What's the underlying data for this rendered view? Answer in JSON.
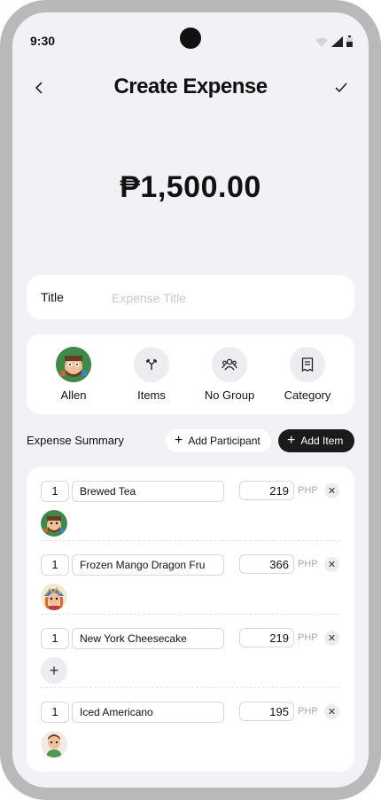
{
  "status": {
    "time": "9:30"
  },
  "header": {
    "title": "Create Expense"
  },
  "amount": "₱1,500.00",
  "title_field": {
    "label": "Title",
    "placeholder": "Expense Title",
    "value": ""
  },
  "options": [
    {
      "label": "Allen",
      "icon": "avatar"
    },
    {
      "label": "Items",
      "icon": "split-icon"
    },
    {
      "label": "No Group",
      "icon": "group-icon"
    },
    {
      "label": "Category",
      "icon": "receipt-icon"
    }
  ],
  "summary": {
    "title": "Expense Summary",
    "add_participant_label": "Add Participant",
    "add_item_label": "Add Item"
  },
  "items": [
    {
      "qty": "1",
      "name": "Brewed Tea",
      "price": "219",
      "currency": "PHP",
      "participant": "avatar-1"
    },
    {
      "qty": "1",
      "name": "Frozen Mango Dragon Fru",
      "price": "366",
      "currency": "PHP",
      "participant": "avatar-2"
    },
    {
      "qty": "1",
      "name": "New York Cheesecake",
      "price": "219",
      "currency": "PHP",
      "participant": "none"
    },
    {
      "qty": "1",
      "name": "Iced Americano",
      "price": "195",
      "currency": "PHP",
      "participant": "avatar-3"
    }
  ],
  "colors": {
    "background": "#f1f1f6",
    "card": "#ffffff",
    "dark_button": "#1b1b1b",
    "frame": "#b9b9b9"
  }
}
